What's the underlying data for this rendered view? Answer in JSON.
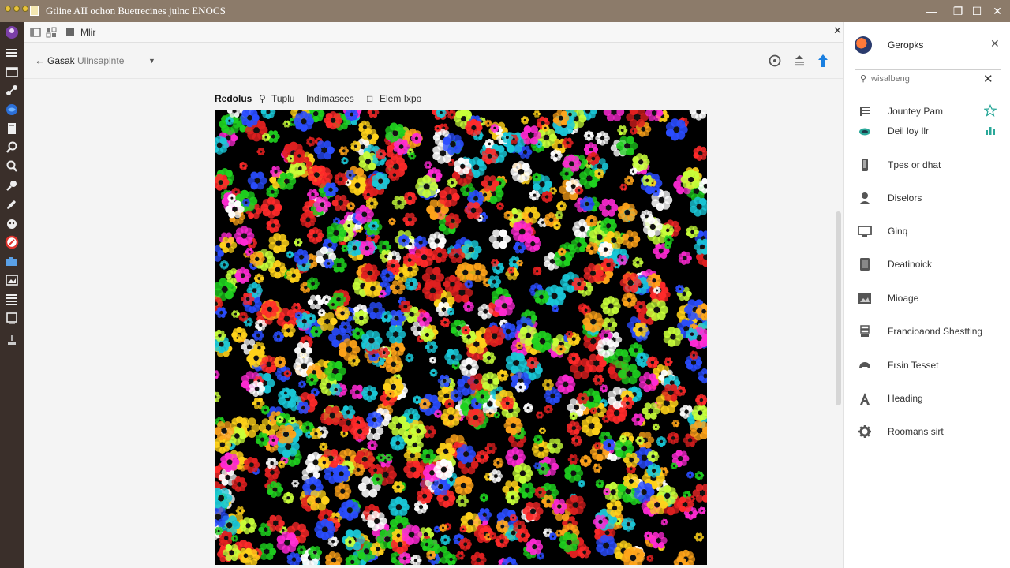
{
  "window": {
    "title": "Gtline AII ochon Buetrecines julnc ENOCS",
    "controls": [
      "minimize",
      "maximize",
      "close"
    ]
  },
  "subbar": {
    "label": "Mlir"
  },
  "header": {
    "back_label": "Gasak",
    "breadcrumb": "Ullnsaplnte",
    "icons": [
      "history-icon",
      "align-icon",
      "upload-arrow-icon"
    ]
  },
  "tabs": [
    {
      "label": "Redolus",
      "active": true
    },
    {
      "label": "Tuplu",
      "icon": "lightbulb-icon"
    },
    {
      "label": "Indimasces"
    },
    {
      "label": "Elem Ixpo",
      "icon": "document-icon"
    }
  ],
  "colors": {
    "titlebar": "#8c7b6a",
    "rail": "#3a2f2a",
    "accent_blue": "#1a7fe0",
    "accent_teal": "#2aa899"
  },
  "panel": {
    "title": "Geropks",
    "search_placeholder": "wisalbeng",
    "items": [
      {
        "label": "Jountey Pam",
        "icon": "list-icon",
        "trail": "star-outline-icon"
      },
      {
        "label": "Deil loy llr",
        "icon": "cloud-icon",
        "trail": "bar-chart-icon"
      },
      {
        "label": "Tpes or dhat",
        "icon": "phone-icon"
      },
      {
        "label": "Diselors",
        "icon": "person-icon"
      },
      {
        "label": "Ginq",
        "icon": "monitor-icon"
      },
      {
        "label": "Deatinoick",
        "icon": "tablet-icon"
      },
      {
        "label": "Mioage",
        "icon": "image-icon"
      },
      {
        "label": "Francioaond Shestting",
        "icon": "stack-icon"
      },
      {
        "label": "Frsin Tesset",
        "icon": "game-controller-icon"
      },
      {
        "label": "Heading",
        "icon": "heading-icon"
      },
      {
        "label": "Roomans sirt",
        "icon": "gear-icon"
      }
    ]
  }
}
